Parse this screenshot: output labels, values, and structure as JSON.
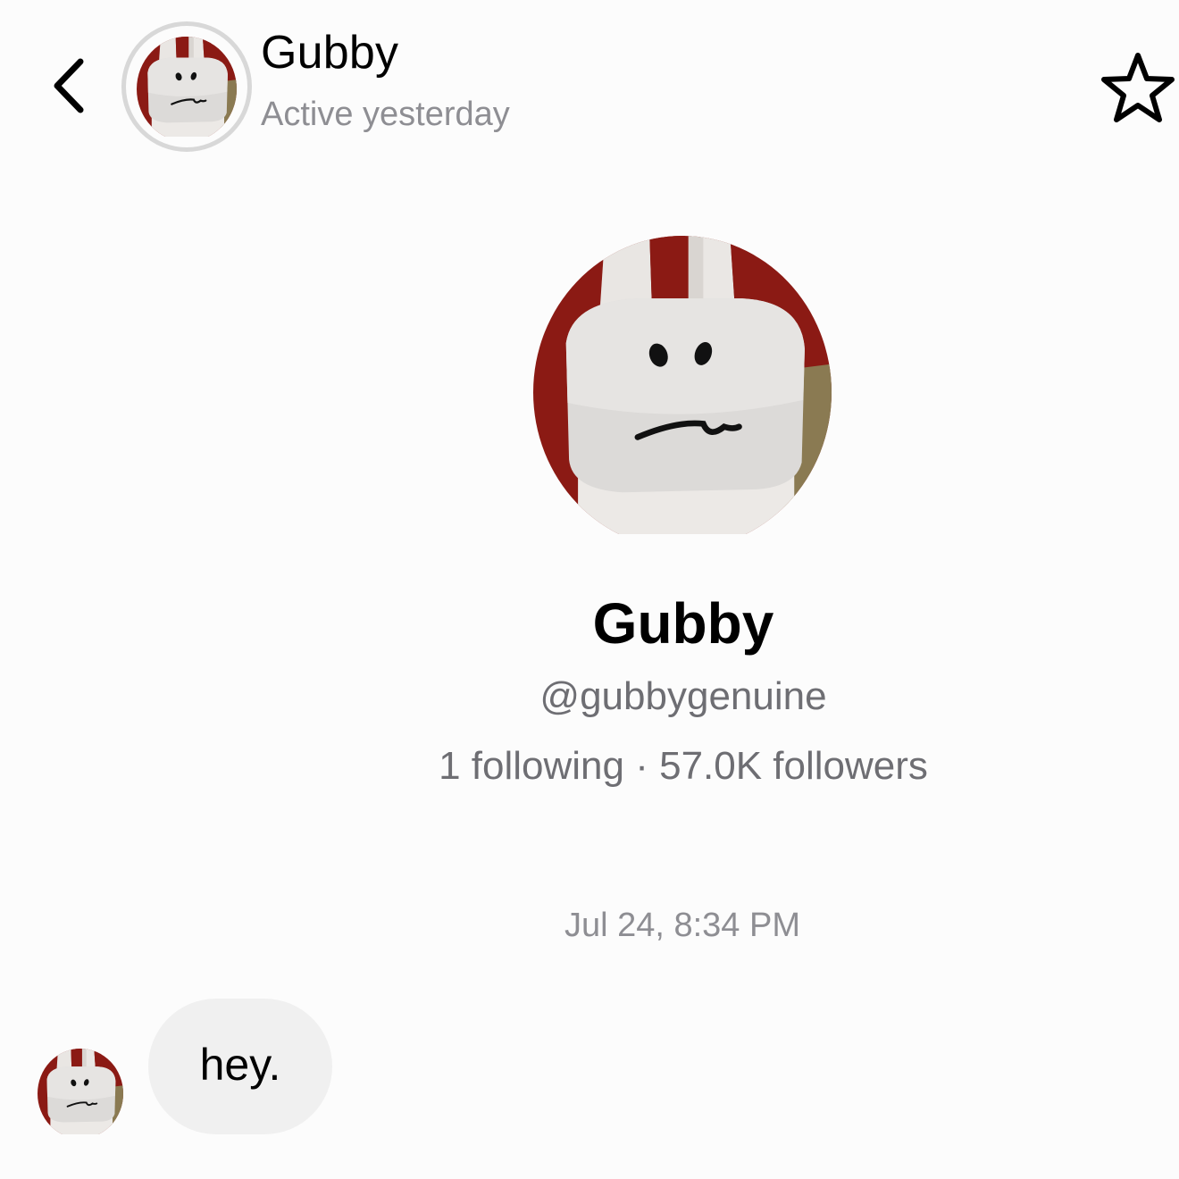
{
  "header": {
    "name": "Gubby",
    "status": "Active yesterday"
  },
  "profile": {
    "display_name": "Gubby",
    "handle": "@gubbygenuine",
    "following": "1 following",
    "separator": "·",
    "followers": "57.0K followers"
  },
  "conversation": {
    "timestamp": "Jul 24, 8:34 PM",
    "messages": [
      {
        "text": "hey."
      }
    ]
  },
  "icons": {
    "back": "chevron-left-icon",
    "favorite": "star-outline-icon"
  },
  "colors": {
    "background": "#fcfcfc",
    "secondary_text": "#8e8e93",
    "bubble": "#f0f0f0",
    "avatar_red": "#8b1a14",
    "avatar_tan": "#8a7a52"
  }
}
